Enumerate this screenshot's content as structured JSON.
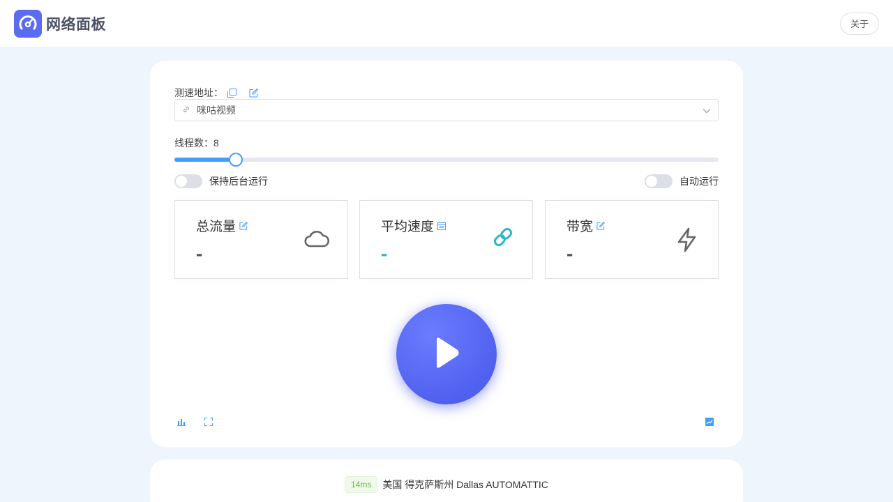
{
  "header": {
    "brand_name": "网络面板",
    "about_label": "关于"
  },
  "config": {
    "url_label": "测速地址：",
    "url_selected": "咪咕视频",
    "threads_label": "线程数：8",
    "threads_value": 8,
    "threads_fraction": 0.113,
    "keep_background_label": "保持后台运行",
    "keep_background_on": false,
    "auto_run_label": "自动运行",
    "auto_run_on": false
  },
  "stats": [
    {
      "title": "总流量",
      "value": "-",
      "icon": "cloud-icon",
      "title_icon": "edit-icon"
    },
    {
      "title": "平均速度",
      "value": "-",
      "icon": "link-icon",
      "title_icon": "calendar-icon"
    },
    {
      "title": "带宽",
      "value": "-",
      "icon": "lightning-icon",
      "title_icon": "edit-icon"
    }
  ],
  "colors": {
    "accent": "#409eff",
    "play": "#5b6cf0",
    "teal": "#25b7d3",
    "ping_green": "#67c23a"
  },
  "server": {
    "ping": "14ms",
    "name": "美国 得克萨斯州 Dallas AUTOMATTIC"
  }
}
